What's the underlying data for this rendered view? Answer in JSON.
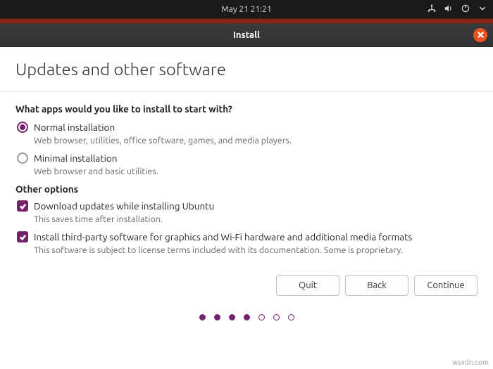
{
  "topbar": {
    "datetime": "May 21  21:21"
  },
  "titlebar": {
    "title": "Install"
  },
  "page": {
    "heading": "Updates and other software",
    "question": "What apps would you like to install to start with?",
    "options": [
      {
        "label": "Normal installation",
        "desc": "Web browser, utilities, office software, games, and media players.",
        "selected": true
      },
      {
        "label": "Minimal installation",
        "desc": "Web browser and basic utilities.",
        "selected": false
      }
    ],
    "other_heading": "Other options",
    "other": [
      {
        "label": "Download updates while installing Ubuntu",
        "desc": "This saves time after installation.",
        "checked": true
      },
      {
        "label": "Install third-party software for graphics and Wi-Fi hardware and additional media formats",
        "desc": "This software is subject to license terms included with its documentation. Some is proprietary.",
        "checked": true
      }
    ]
  },
  "buttons": {
    "quit": "Quit",
    "back": "Back",
    "continue": "Continue"
  },
  "progress": {
    "total": 7,
    "filled": 4
  },
  "watermark": "wsxdn.com"
}
